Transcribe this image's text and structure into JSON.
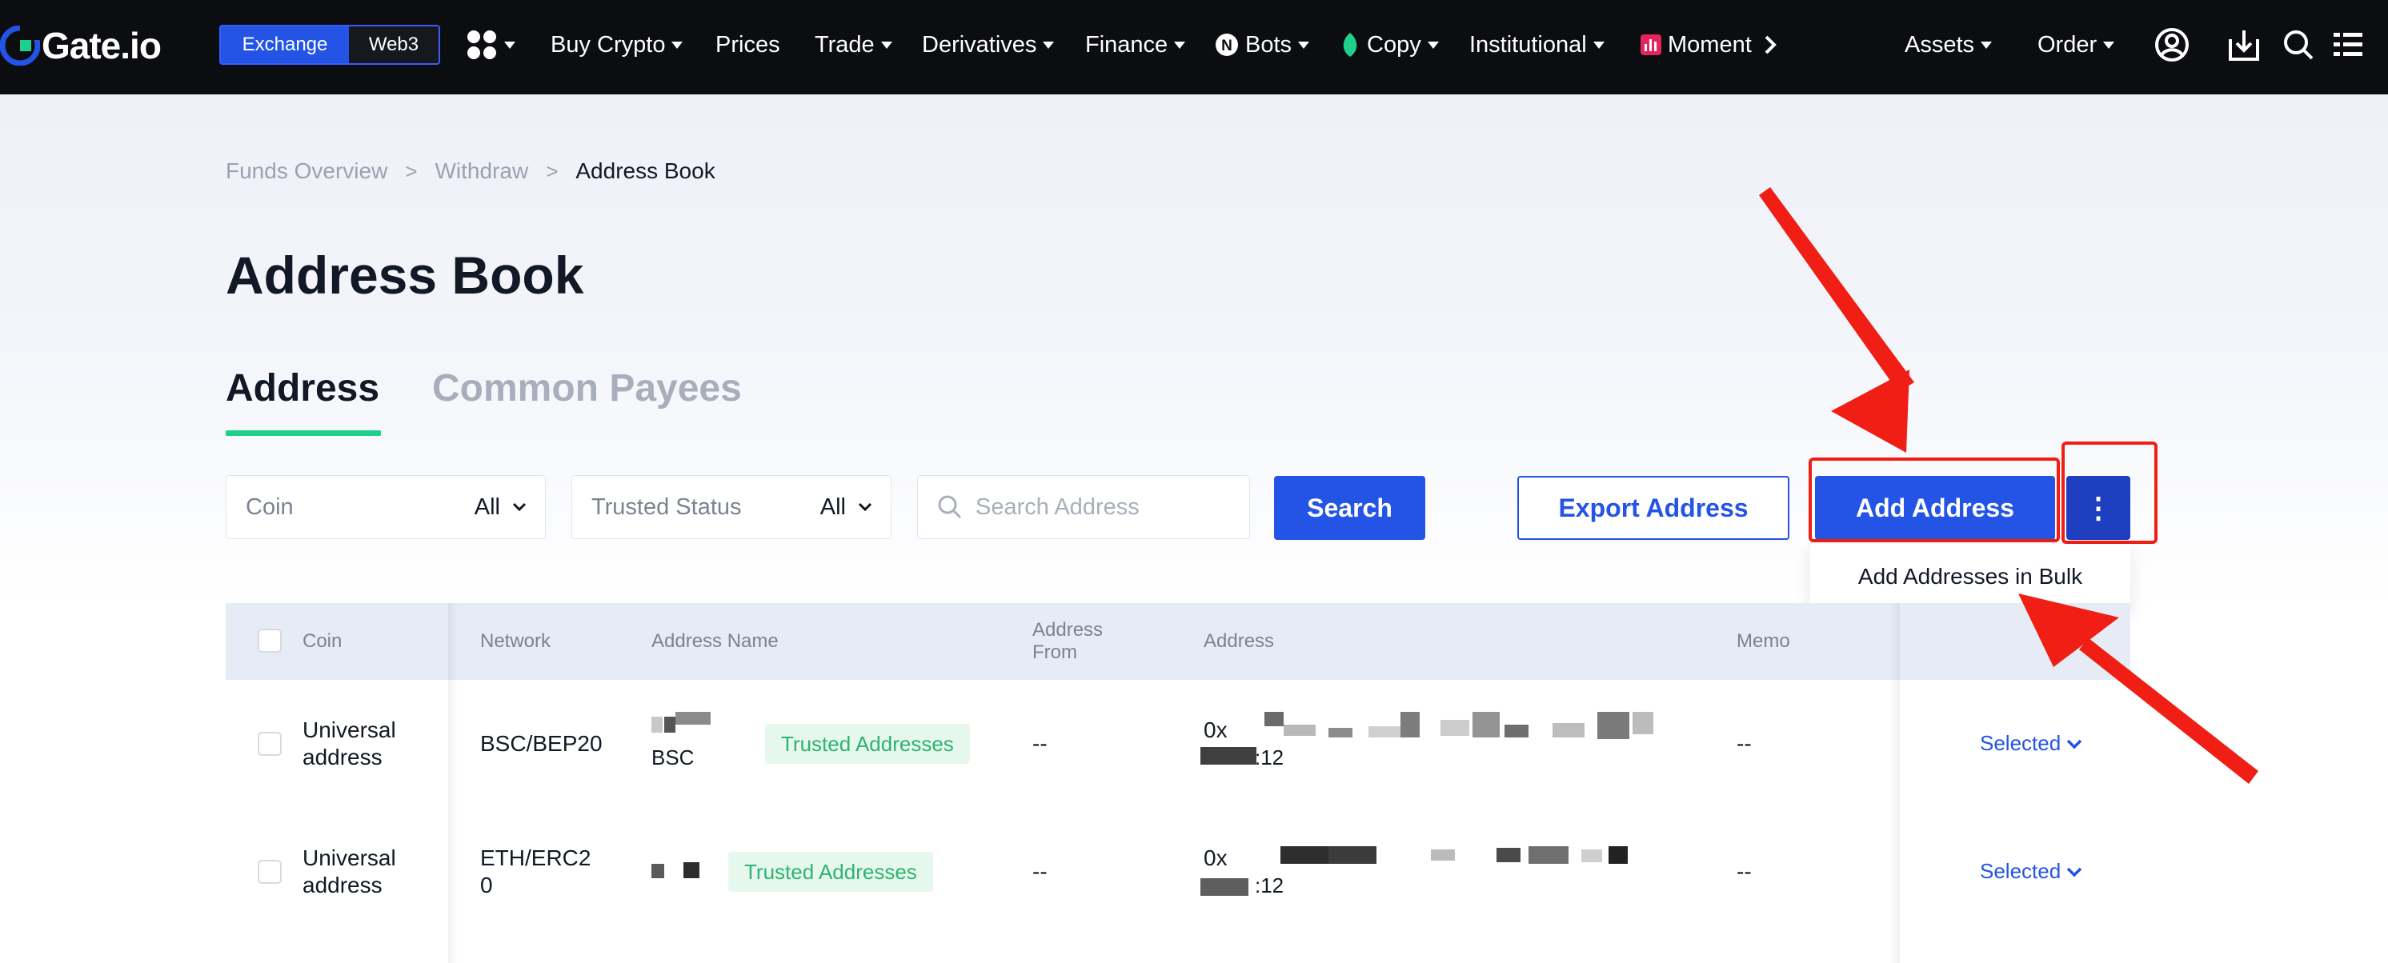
{
  "colors": {
    "brand_blue": "#2354e6",
    "accent_green": "#1fd08c",
    "annotation_red": "#f01e14",
    "trusted_bg": "#e6f8ee",
    "trusted_text": "#2fb370"
  },
  "topnav": {
    "logo_text": "Gate.io",
    "segment": {
      "active": "Exchange",
      "inactive": "Web3"
    },
    "items": [
      {
        "label": "Buy Crypto"
      },
      {
        "label": "Prices"
      },
      {
        "label": "Trade"
      },
      {
        "label": "Derivatives"
      },
      {
        "label": "Finance"
      },
      {
        "label": "Bots"
      },
      {
        "label": "Copy"
      },
      {
        "label": "Institutional"
      },
      {
        "label": "Moment"
      }
    ],
    "right": {
      "assets": "Assets",
      "order": "Order"
    },
    "icons": [
      "apps-icon",
      "bots-icon",
      "copy-leaf-icon",
      "moment-icon",
      "chevron-right-icon",
      "user-icon",
      "download-icon",
      "search-icon",
      "menu-icon"
    ]
  },
  "breadcrumb": [
    "Funds Overview",
    "Withdraw",
    "Address Book"
  ],
  "page_title": "Address Book",
  "tabs": [
    {
      "label": "Address",
      "active": true
    },
    {
      "label": "Common Payees",
      "active": false
    }
  ],
  "filters": {
    "coin": {
      "label": "Coin",
      "value": "All"
    },
    "trusted": {
      "label": "Trusted Status",
      "value": "All"
    },
    "search": {
      "placeholder": "Search Address",
      "value": ""
    }
  },
  "buttons": {
    "search": "Search",
    "export": "Export Address",
    "add": "Add Address",
    "more": "⋮"
  },
  "more_menu": [
    "Add Addresses in Bulk"
  ],
  "table": {
    "columns": [
      "Coin",
      "Network",
      "Address Name",
      "Address From",
      "Address",
      "Memo"
    ],
    "rows": [
      {
        "coin": "Universal address",
        "network": "BSC/BEP20",
        "name": "BSC",
        "badge": "Trusted Addresses",
        "from": "--",
        "address_prefix": "0x",
        "address_suffix": ":12",
        "memo": "--",
        "action": "Selected"
      },
      {
        "coin": "Universal address",
        "network": "ETH/ERC20",
        "name": "",
        "badge": "Trusted Addresses",
        "from": "--",
        "address_prefix": "0x",
        "address_suffix": ":12",
        "memo": "--",
        "action": "Selected"
      }
    ]
  }
}
